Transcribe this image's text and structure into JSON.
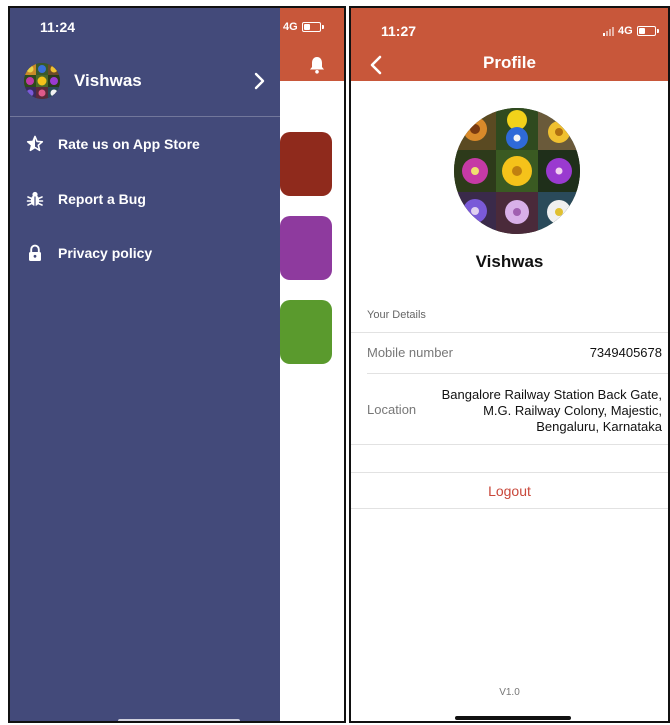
{
  "left_screen": {
    "status_time": "11:24",
    "network": "4G",
    "colors": {
      "drawer": "#434a7a",
      "header": "#c8573a",
      "card_1": "#8f2a1c",
      "card_2": "#8e3a9e",
      "card_3": "#5a9a2d"
    },
    "header_icon": "bell-icon",
    "drawer": {
      "username": "Vishwas",
      "menu_items": [
        {
          "label": "Rate us on App Store",
          "icon": "star-icon"
        },
        {
          "label": "Report a Bug",
          "icon": "bug-icon"
        },
        {
          "label": "Privacy policy",
          "icon": "lock-icon"
        }
      ]
    }
  },
  "right_screen": {
    "status_time": "11:27",
    "network": "4G",
    "title": "Profile",
    "name": "Vishwas",
    "section_label": "Your Details",
    "details": [
      {
        "label": "Mobile number",
        "value": "7349405678"
      },
      {
        "label": "Location",
        "value_lines": [
          "Bangalore Railway Station Back Gate,",
          "M.G. Railway Colony, Majestic,",
          "Bengaluru, Karnataka"
        ]
      }
    ],
    "logout_label": "Logout",
    "version": "V1.0"
  }
}
